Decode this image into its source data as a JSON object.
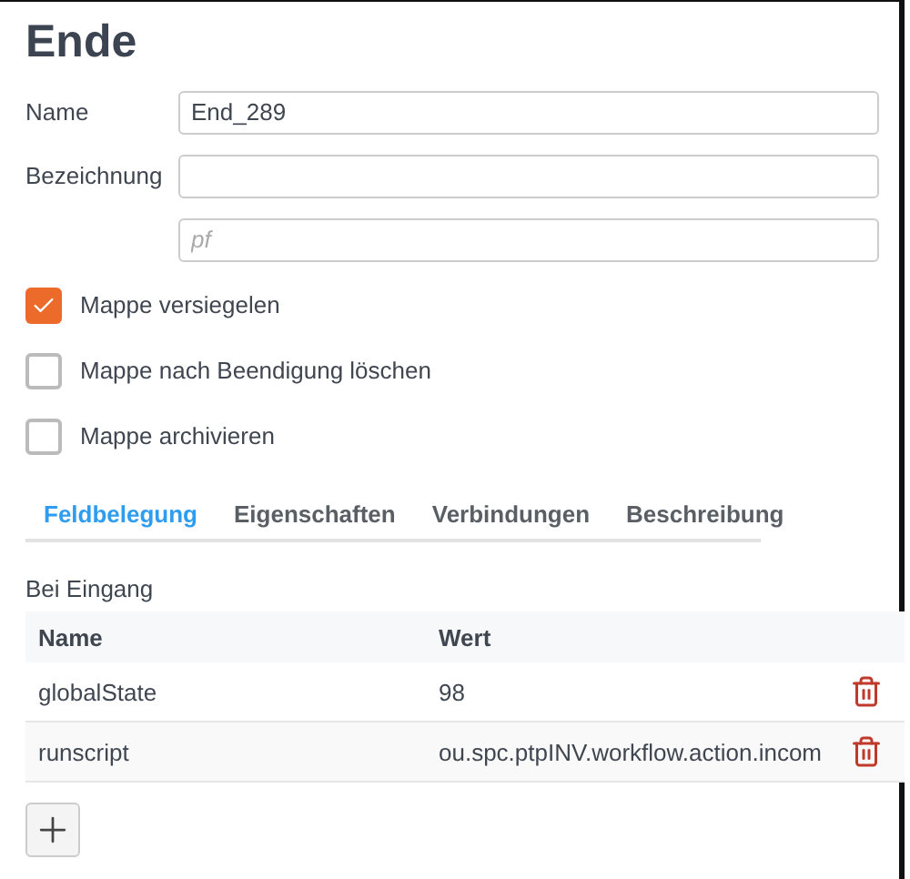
{
  "title": "Ende",
  "fields": [
    {
      "label": "Name",
      "value": "End_289"
    },
    {
      "label": "Bezeichnung"
    },
    {
      "placeholder": "pf"
    }
  ],
  "options": [
    {
      "label": "Mappe versiegelen",
      "checked": true
    },
    {
      "label": "Mappe nach Beendigung löschen",
      "checked": false
    },
    {
      "label": "Mappe archivieren",
      "checked": false
    }
  ],
  "tabs": [
    {
      "label": "Feldbelegung",
      "selected": true
    },
    {
      "label": "Eigenschaften",
      "selected": false
    },
    {
      "label": "Verbindungen",
      "selected": false
    },
    {
      "label": "Beschreibung",
      "selected": false
    }
  ],
  "section": "Bei Eingang",
  "table": {
    "columns": [
      "Name",
      "Wert"
    ],
    "rows": [
      {
        "name": "globalState",
        "value": "98"
      },
      {
        "name": "runscript",
        "value": "ou.spc.ptpINV.workflow.action.incom"
      }
    ]
  }
}
